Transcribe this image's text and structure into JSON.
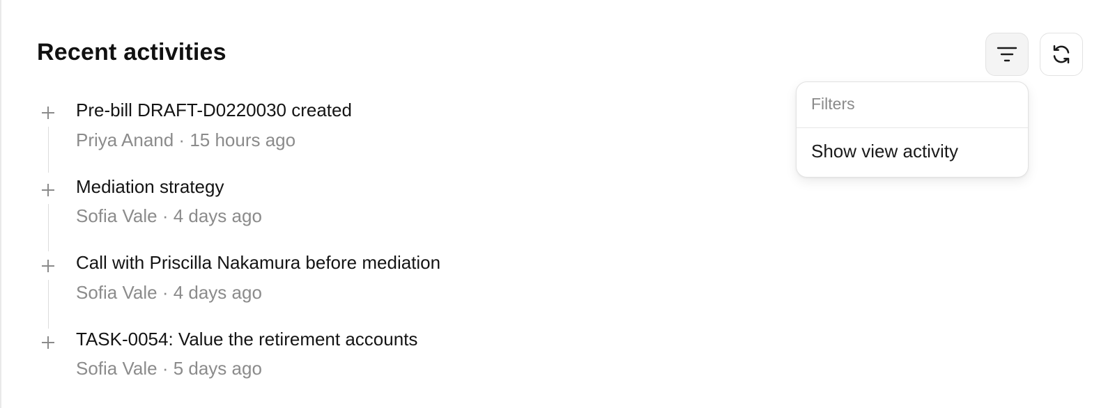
{
  "header": {
    "title": "Recent activities",
    "filter_icon": "filter-lines-icon",
    "refresh_icon": "refresh-icon"
  },
  "filters_menu": {
    "header": "Filters",
    "items": [
      {
        "label": "Show view activity"
      }
    ]
  },
  "activities": [
    {
      "title": "Pre-bill DRAFT-D0220030 created",
      "author": "Priya Anand",
      "separator": "·",
      "time": "15 hours ago",
      "meta": "Priya Anand · 15 hours ago",
      "icon": "plus-icon"
    },
    {
      "title": "Mediation strategy",
      "author": "Sofia Vale",
      "separator": "·",
      "time": "4 days ago",
      "meta": "Sofia Vale · 4 days ago",
      "icon": "plus-icon"
    },
    {
      "title": "Call with Priscilla Nakamura before mediation",
      "author": "Sofia Vale",
      "separator": "·",
      "time": "4 days ago",
      "meta": "Sofia Vale · 4 days ago",
      "icon": "plus-icon"
    },
    {
      "title": "TASK-0054: Value the retirement accounts",
      "author": "Sofia Vale",
      "separator": "·",
      "time": "5 days ago",
      "meta": "Sofia Vale · 5 days ago",
      "icon": "plus-icon"
    }
  ],
  "colors": {
    "title": "#111111",
    "muted": "#8b8b8b",
    "border": "#e2e2e2",
    "active_button_bg": "#f4f4f4"
  }
}
